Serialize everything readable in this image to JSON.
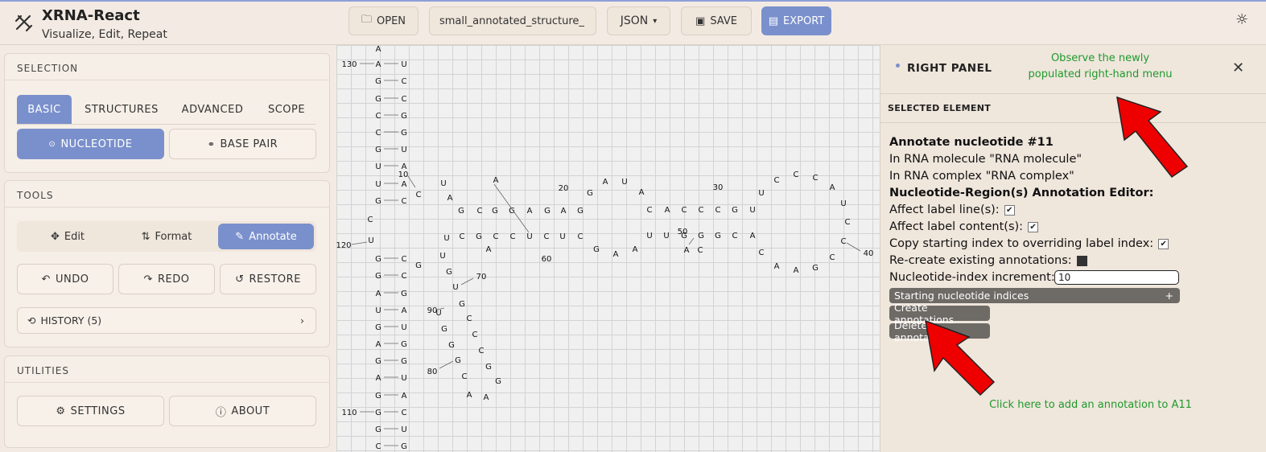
{
  "app": {
    "title": "XRNA-React",
    "subtitle": "Visualize, Edit, Repeat",
    "logo_icon": "xrna-logo-icon"
  },
  "toolbar": {
    "open_label": "OPEN",
    "filename_value": "small_annotated_structure_",
    "format_value": "JSON",
    "save_label": "SAVE",
    "export_label": "EXPORT",
    "theme_icon": "sun-icon"
  },
  "selection": {
    "title": "SELECTION",
    "tabs": [
      {
        "label": "BASIC",
        "active": true
      },
      {
        "label": "STRUCTURES",
        "active": false
      },
      {
        "label": "ADVANCED",
        "active": false
      },
      {
        "label": "SCOPE",
        "active": false
      }
    ],
    "nucleotide_label": "NUCLEOTIDE",
    "base_pair_label": "BASE PAIR"
  },
  "tools": {
    "title": "TOOLS",
    "modes": [
      {
        "label": "Edit",
        "icon": "move-icon",
        "active": false
      },
      {
        "label": "Format",
        "icon": "format-icon",
        "active": false
      },
      {
        "label": "Annotate",
        "icon": "pencil-icon",
        "active": true
      }
    ],
    "undo_label": "UNDO",
    "redo_label": "REDO",
    "restore_label": "RESTORE",
    "history_label": "HISTORY (5)"
  },
  "utilities": {
    "title": "UTILITIES",
    "settings_label": "SETTINGS",
    "about_label": "ABOUT"
  },
  "canvas": {
    "labels": [
      "130",
      "120",
      "110",
      "90",
      "80",
      "70",
      "60",
      "50",
      "40",
      "30",
      "20",
      "10"
    ]
  },
  "right_panel": {
    "title": "RIGHT PANEL",
    "section": "SELECTED ELEMENT",
    "heading": "Annotate nucleotide #11",
    "molecule": "In RNA molecule \"RNA molecule\"",
    "complex": "In RNA complex \"RNA complex\"",
    "editor_heading": "Nucleotide-Region(s) Annotation Editor:",
    "options": [
      {
        "label": "Affect label line(s):",
        "checked": true
      },
      {
        "label": "Affect label content(s):",
        "checked": true
      },
      {
        "label": "Copy starting index to overriding label index:",
        "checked": true
      },
      {
        "label": "Re-create existing annotations:",
        "checked": false
      }
    ],
    "increment_label": "Nucleotide-index increment:",
    "increment_value": "10",
    "starting_indices_label": "Starting nucleotide indices",
    "plus_symbol": "+",
    "create_label": "Create annotations",
    "delete_label": "Delete annotations"
  },
  "annotations": {
    "top_note_line1": "Observe the newly",
    "top_note_line2": "populated right-hand menu",
    "bottom_note": "Click here to add an annotation to A11",
    "arrow_color": "#ee0000",
    "note_color": "#1f9a2c"
  }
}
